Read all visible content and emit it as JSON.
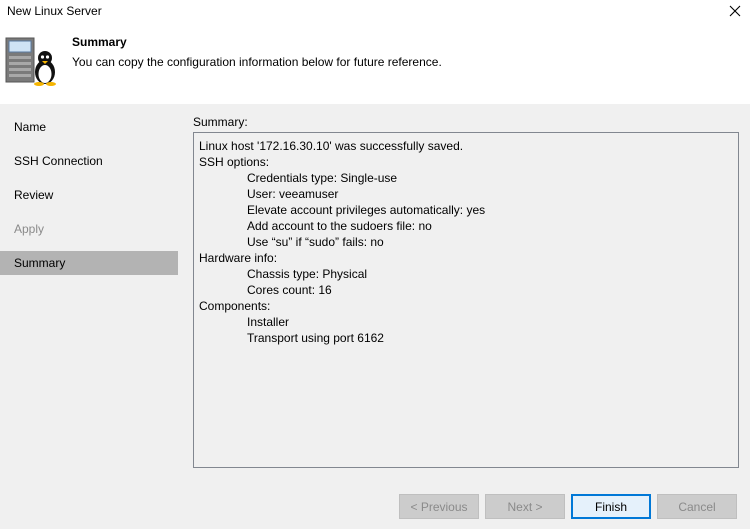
{
  "window": {
    "title": "New Linux Server"
  },
  "header": {
    "title": "Summary",
    "subtitle": "You can copy the configuration information below for future reference.",
    "icon": "linux-server-icon"
  },
  "steps": [
    {
      "label": "Name",
      "state": "normal"
    },
    {
      "label": "SSH Connection",
      "state": "normal"
    },
    {
      "label": "Review",
      "state": "normal"
    },
    {
      "label": "Apply",
      "state": "disabled"
    },
    {
      "label": "Summary",
      "state": "active"
    }
  ],
  "summary": {
    "label": "Summary:",
    "lines": [
      {
        "text": "Linux host '172.16.30.10' was successfully saved.",
        "indent": false
      },
      {
        "text": "SSH options:",
        "indent": false
      },
      {
        "text": "Credentials type: Single-use",
        "indent": true
      },
      {
        "text": "User: veeamuser",
        "indent": true
      },
      {
        "text": "Elevate account privileges automatically: yes",
        "indent": true
      },
      {
        "text": "Add account to the sudoers file: no",
        "indent": true
      },
      {
        "text": "Use “su” if “sudo” fails: no",
        "indent": true
      },
      {
        "text": "Hardware info:",
        "indent": false
      },
      {
        "text": "Chassis type: Physical",
        "indent": true
      },
      {
        "text": "Cores count: 16",
        "indent": true
      },
      {
        "text": "Components:",
        "indent": false
      },
      {
        "text": "Installer",
        "indent": true
      },
      {
        "text": "Transport using port 6162",
        "indent": true
      }
    ]
  },
  "buttons": {
    "previous": "< Previous",
    "next": "Next >",
    "finish": "Finish",
    "cancel": "Cancel"
  },
  "colors": {
    "accent": "#0078d7",
    "active_step": "#b3b3b3",
    "panel": "#f0f0f0"
  }
}
